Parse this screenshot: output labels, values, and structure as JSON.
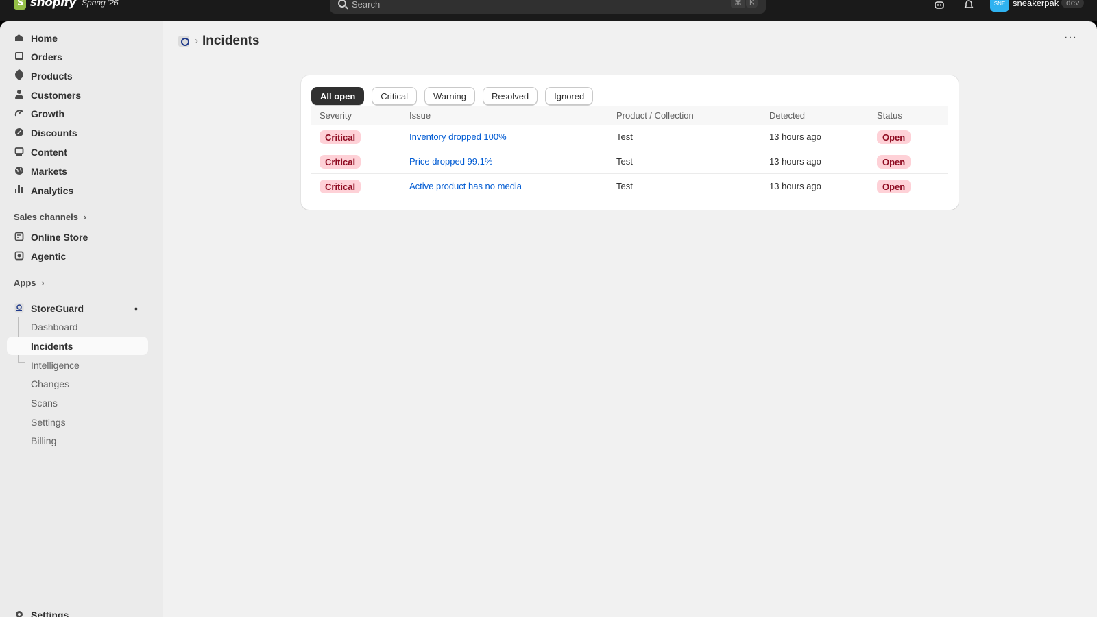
{
  "topbar": {
    "brand": "shopify",
    "edition": "Spring '26",
    "search_placeholder": "Search",
    "shortcut_mod": "⌘",
    "shortcut_key": "K",
    "avatar_initials": "SNE",
    "store_name": "sneakerpak",
    "env_badge": "dev"
  },
  "sidebar": {
    "items": [
      {
        "label": "Home",
        "icon": "home-icon"
      },
      {
        "label": "Orders",
        "icon": "orders-icon"
      },
      {
        "label": "Products",
        "icon": "tag-icon"
      },
      {
        "label": "Customers",
        "icon": "person-icon"
      },
      {
        "label": "Growth",
        "icon": "growth-icon"
      },
      {
        "label": "Discounts",
        "icon": "discount-icon"
      },
      {
        "label": "Content",
        "icon": "content-icon"
      },
      {
        "label": "Markets",
        "icon": "globe-icon"
      },
      {
        "label": "Analytics",
        "icon": "bar-chart-icon"
      }
    ],
    "sales_channels_label": "Sales channels",
    "channels": [
      {
        "label": "Online Store",
        "icon": "store-icon"
      },
      {
        "label": "Agentic",
        "icon": "agentic-icon"
      }
    ],
    "apps_label": "Apps",
    "app": {
      "label": "StoreGuard",
      "pin": "•",
      "subitems": [
        "Dashboard",
        "Incidents",
        "Intelligence",
        "Changes",
        "Scans",
        "Settings",
        "Billing"
      ],
      "active_subitem": "Incidents"
    },
    "footer_label": "Settings"
  },
  "page": {
    "title": "Incidents",
    "more": "···"
  },
  "filters": {
    "tabs": [
      "All open",
      "Critical",
      "Warning",
      "Resolved",
      "Ignored"
    ],
    "active": "All open"
  },
  "table": {
    "columns": [
      "Severity",
      "Issue",
      "Product / Collection",
      "Detected",
      "Status"
    ],
    "rows": [
      {
        "severity": "Critical",
        "issue": "Inventory dropped 100%",
        "product": "Test",
        "detected": "13 hours ago",
        "status": "Open"
      },
      {
        "severity": "Critical",
        "issue": "Price dropped 99.1%",
        "product": "Test",
        "detected": "13 hours ago",
        "status": "Open"
      },
      {
        "severity": "Critical",
        "issue": "Active product has no media",
        "product": "Test",
        "detected": "13 hours ago",
        "status": "Open"
      }
    ]
  },
  "colors": {
    "topbar": "#1a1a1a",
    "link": "#005bd3",
    "critical_bg": "#fed1d7",
    "critical_text": "#8e0b21",
    "avatar": "#2fb2f0"
  }
}
